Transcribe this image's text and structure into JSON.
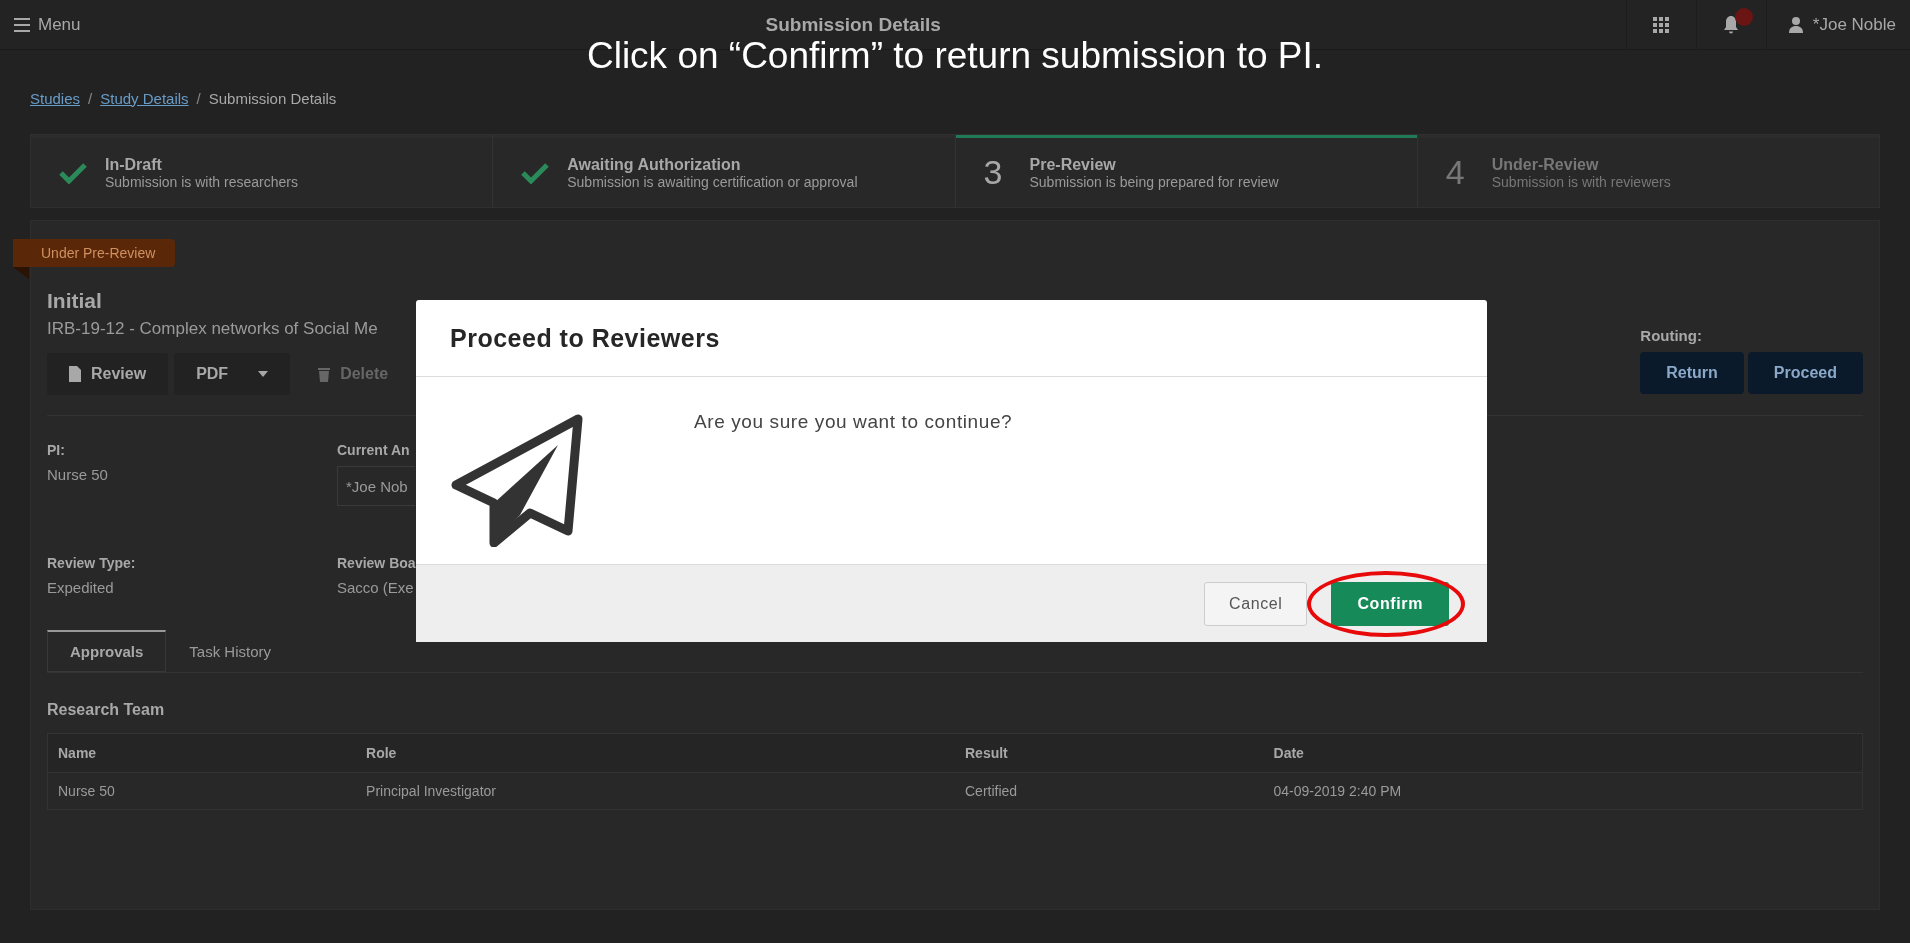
{
  "caption": "Click on “Confirm” to return submission to PI.",
  "topbar": {
    "menu": "Menu",
    "title": "Submission Details",
    "user": "*Joe Noble"
  },
  "breadcrumb": {
    "separator": "/",
    "items": [
      {
        "label": "Studies",
        "link": true
      },
      {
        "label": "Study Details",
        "link": true
      },
      {
        "label": "Submission Details",
        "link": false
      }
    ]
  },
  "steps": [
    {
      "title": "In-Draft",
      "subtitle": "Submission is with researchers",
      "completed": true,
      "selected": false
    },
    {
      "title": "Awaiting Authorization",
      "subtitle": "Submission is awaiting certification or approval",
      "completed": true,
      "selected": false
    },
    {
      "number": "3",
      "title": "Pre-Review",
      "subtitle": "Submission is being prepared for review",
      "completed": false,
      "selected": true
    },
    {
      "number": "4",
      "title": "Under-Review",
      "subtitle": "Submission is with reviewers",
      "completed": false,
      "selected": false
    }
  ],
  "submission": {
    "status_ribbon": "Under Pre-Review",
    "type": "Initial",
    "title": "IRB-19-12 - Complex networks of Social Me",
    "actions": [
      {
        "label": "Review",
        "kind": "document",
        "disabled": false
      },
      {
        "label": "PDF",
        "kind": "dropdown",
        "disabled": false
      },
      {
        "label": "Delete",
        "kind": "trash",
        "disabled": true
      }
    ],
    "routing": {
      "label": "Routing:",
      "buttons": [
        "Return",
        "Proceed"
      ]
    },
    "fields": [
      {
        "label": "PI:",
        "value": "Nurse 50",
        "kind": "text"
      },
      {
        "label": "Current An",
        "value": "*Joe Nob",
        "kind": "input"
      },
      {
        "label": "Review Type:",
        "value": "Expedited",
        "kind": "text"
      },
      {
        "label": "Review Boa",
        "value": "Sacco (Exe",
        "kind": "text"
      }
    ]
  },
  "tabs": [
    {
      "label": "Approvals",
      "selected": true
    },
    {
      "label": "Task History",
      "selected": false
    }
  ],
  "research_team": {
    "title": "Research Team",
    "columns": [
      "Name",
      "Role",
      "Result",
      "Date"
    ],
    "rows": [
      [
        "Nurse 50",
        "Principal Investigator",
        "Certified",
        "04-09-2019 2:40 PM"
      ]
    ]
  },
  "modal": {
    "title": "Proceed to Reviewers",
    "message": "Are you sure you want to continue?",
    "buttons": [
      {
        "label": "Cancel",
        "kind": "secondary",
        "highlighted": false
      },
      {
        "label": "Confirm",
        "kind": "primary",
        "highlighted": true
      }
    ]
  }
}
